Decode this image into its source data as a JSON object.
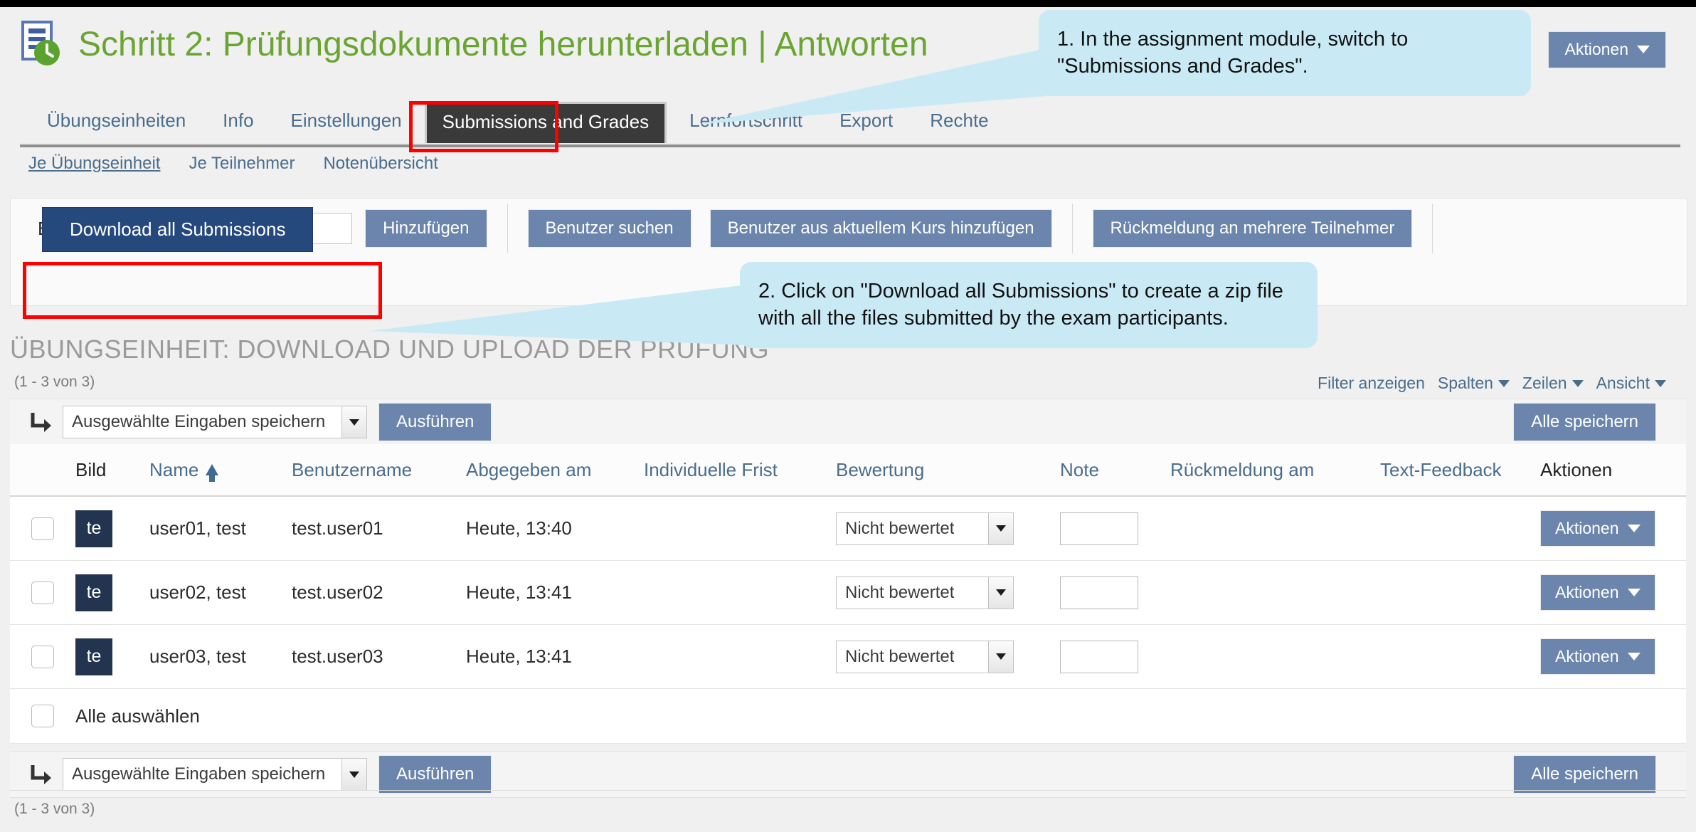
{
  "page": {
    "title": "Schritt 2: Prüfungsdokumente herunterladen | Antworten",
    "app_icon": "document-clock-icon",
    "top_action_label": "Aktionen"
  },
  "tabs": [
    {
      "label": "Übungseinheiten",
      "active": false
    },
    {
      "label": "Info",
      "active": false
    },
    {
      "label": "Einstellungen",
      "active": false
    },
    {
      "label": "Submissions and Grades",
      "active": true
    },
    {
      "label": "Lernfortschritt",
      "active": false
    },
    {
      "label": "Export",
      "active": false
    },
    {
      "label": "Rechte",
      "active": false
    }
  ],
  "subtabs": [
    {
      "label": "Je Übungseinheit",
      "active": true
    },
    {
      "label": "Je Teilnehmer",
      "active": false
    },
    {
      "label": "Notenübersicht",
      "active": false
    }
  ],
  "toolbar": {
    "user_label": "Benutzer",
    "user_value": "",
    "user_placeholder": "",
    "add_label": "Hinzufügen",
    "search_label": "Benutzer suchen",
    "add_from_course_label": "Benutzer aus aktuellem Kurs hinzufügen",
    "feedback_multi_label": "Rückmeldung an mehrere Teilnehmer",
    "download_all_label": "Download all Submissions"
  },
  "section": {
    "heading": "ÜBUNGSEINHEIT: DOWNLOAD UND UPLOAD DER PRÜFUNG",
    "count_top": "(1 - 3 von 3)",
    "count_bottom": "(1 - 3 von 3)"
  },
  "filterbar": [
    {
      "label": "Filter anzeigen",
      "caret": false
    },
    {
      "label": "Spalten",
      "caret": true
    },
    {
      "label": "Zeilen",
      "caret": true
    },
    {
      "label": "Ansicht",
      "caret": true
    }
  ],
  "action_row": {
    "select_value": "Ausgewählte Eingaben speichern",
    "execute_label": "Ausführen",
    "save_all_label": "Alle speichern"
  },
  "table": {
    "columns": [
      {
        "label": "Bild",
        "sortable": false
      },
      {
        "label": "Name",
        "sortable": true,
        "sort": "asc"
      },
      {
        "label": "Benutzername",
        "sortable": true
      },
      {
        "label": "Abgegeben am",
        "sortable": true
      },
      {
        "label": "Individuelle Frist",
        "sortable": true
      },
      {
        "label": "Bewertung",
        "sortable": true
      },
      {
        "label": "Note",
        "sortable": true
      },
      {
        "label": "Rückmeldung am",
        "sortable": true
      },
      {
        "label": "Text-Feedback",
        "sortable": true
      },
      {
        "label": "Aktionen",
        "sortable": false
      }
    ],
    "rows": [
      {
        "checked": false,
        "avatar": "te",
        "name": "user01, test",
        "username": "test.user01",
        "submitted": "Heute, 13:40",
        "deadline": "",
        "grading": "Nicht bewertet",
        "note": "",
        "feedback_date": "",
        "text_feedback": "",
        "action_label": "Aktionen"
      },
      {
        "checked": false,
        "avatar": "te",
        "name": "user02, test",
        "username": "test.user02",
        "submitted": "Heute, 13:41",
        "deadline": "",
        "grading": "Nicht bewertet",
        "note": "",
        "feedback_date": "",
        "text_feedback": "",
        "action_label": "Aktionen"
      },
      {
        "checked": false,
        "avatar": "te",
        "name": "user03, test",
        "username": "test.user03",
        "submitted": "Heute, 13:41",
        "deadline": "",
        "grading": "Nicht bewertet",
        "note": "",
        "feedback_date": "",
        "text_feedback": "",
        "action_label": "Aktionen"
      }
    ],
    "select_all_label": "Alle auswählen"
  },
  "callouts": [
    {
      "text": "1. In the assignment module, switch to \"Submissions and Grades\"."
    },
    {
      "text": "2. Click on \"Download all Submissions\" to create a zip file with all the files submitted by the exam participants."
    }
  ],
  "colors": {
    "title_green": "#6aa531",
    "button_blue": "#6b85ad",
    "download_blue": "#26497d",
    "link_blue": "#4a6d8c",
    "callout_blue": "#c9eaf5",
    "highlight_red": "#ff0000",
    "avatar_navy": "#22344f"
  }
}
